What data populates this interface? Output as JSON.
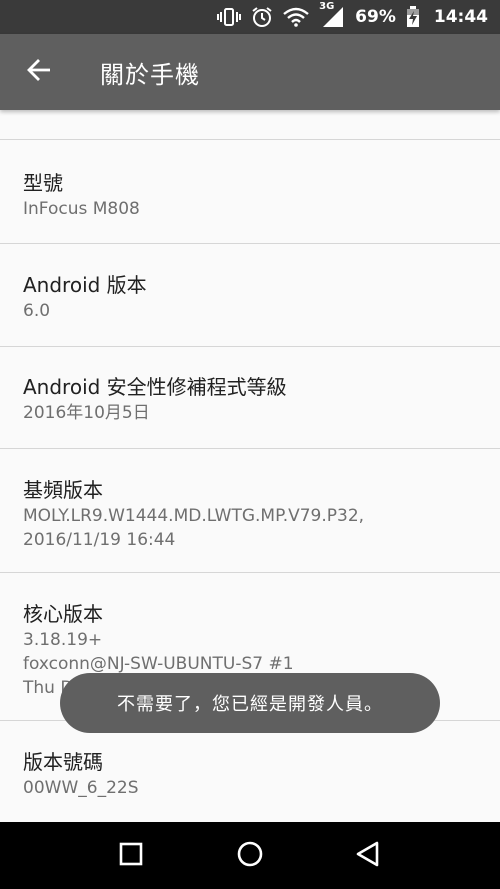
{
  "status_bar": {
    "battery_percent": "69%",
    "time": "14:44",
    "network_type": "3G",
    "icons": [
      "vibrate-icon",
      "alarm-icon",
      "wifi-icon",
      "cell-signal-icon",
      "battery-charging-icon"
    ]
  },
  "app_bar": {
    "title": "關於手機",
    "back_icon": "arrow-left-icon"
  },
  "items": [
    {
      "title": "型號",
      "sub": [
        "InFocus M808"
      ]
    },
    {
      "title": "Android 版本",
      "sub": [
        "6.0"
      ]
    },
    {
      "title": "Android 安全性修補程式等級",
      "sub": [
        "2016年10月5日"
      ]
    },
    {
      "title": "基頻版本",
      "sub": [
        "MOLY.LR9.W1444.MD.LWTG.MP.V79.P32,",
        "2016/11/19 16:44"
      ]
    },
    {
      "title": "核心版本",
      "sub": [
        "3.18.19+",
        "foxconn@NJ-SW-UBUNTU-S7 #1",
        "Thu Dec 29 12:06:03 CST 2016"
      ]
    },
    {
      "title": "版本號碼",
      "sub": [
        "00WW_6_22S"
      ]
    }
  ],
  "toast": {
    "message": "不需要了，您已經是開發人員。"
  },
  "nav_bar": {
    "icons": [
      "recents-square-icon",
      "home-circle-icon",
      "back-triangle-icon"
    ]
  }
}
